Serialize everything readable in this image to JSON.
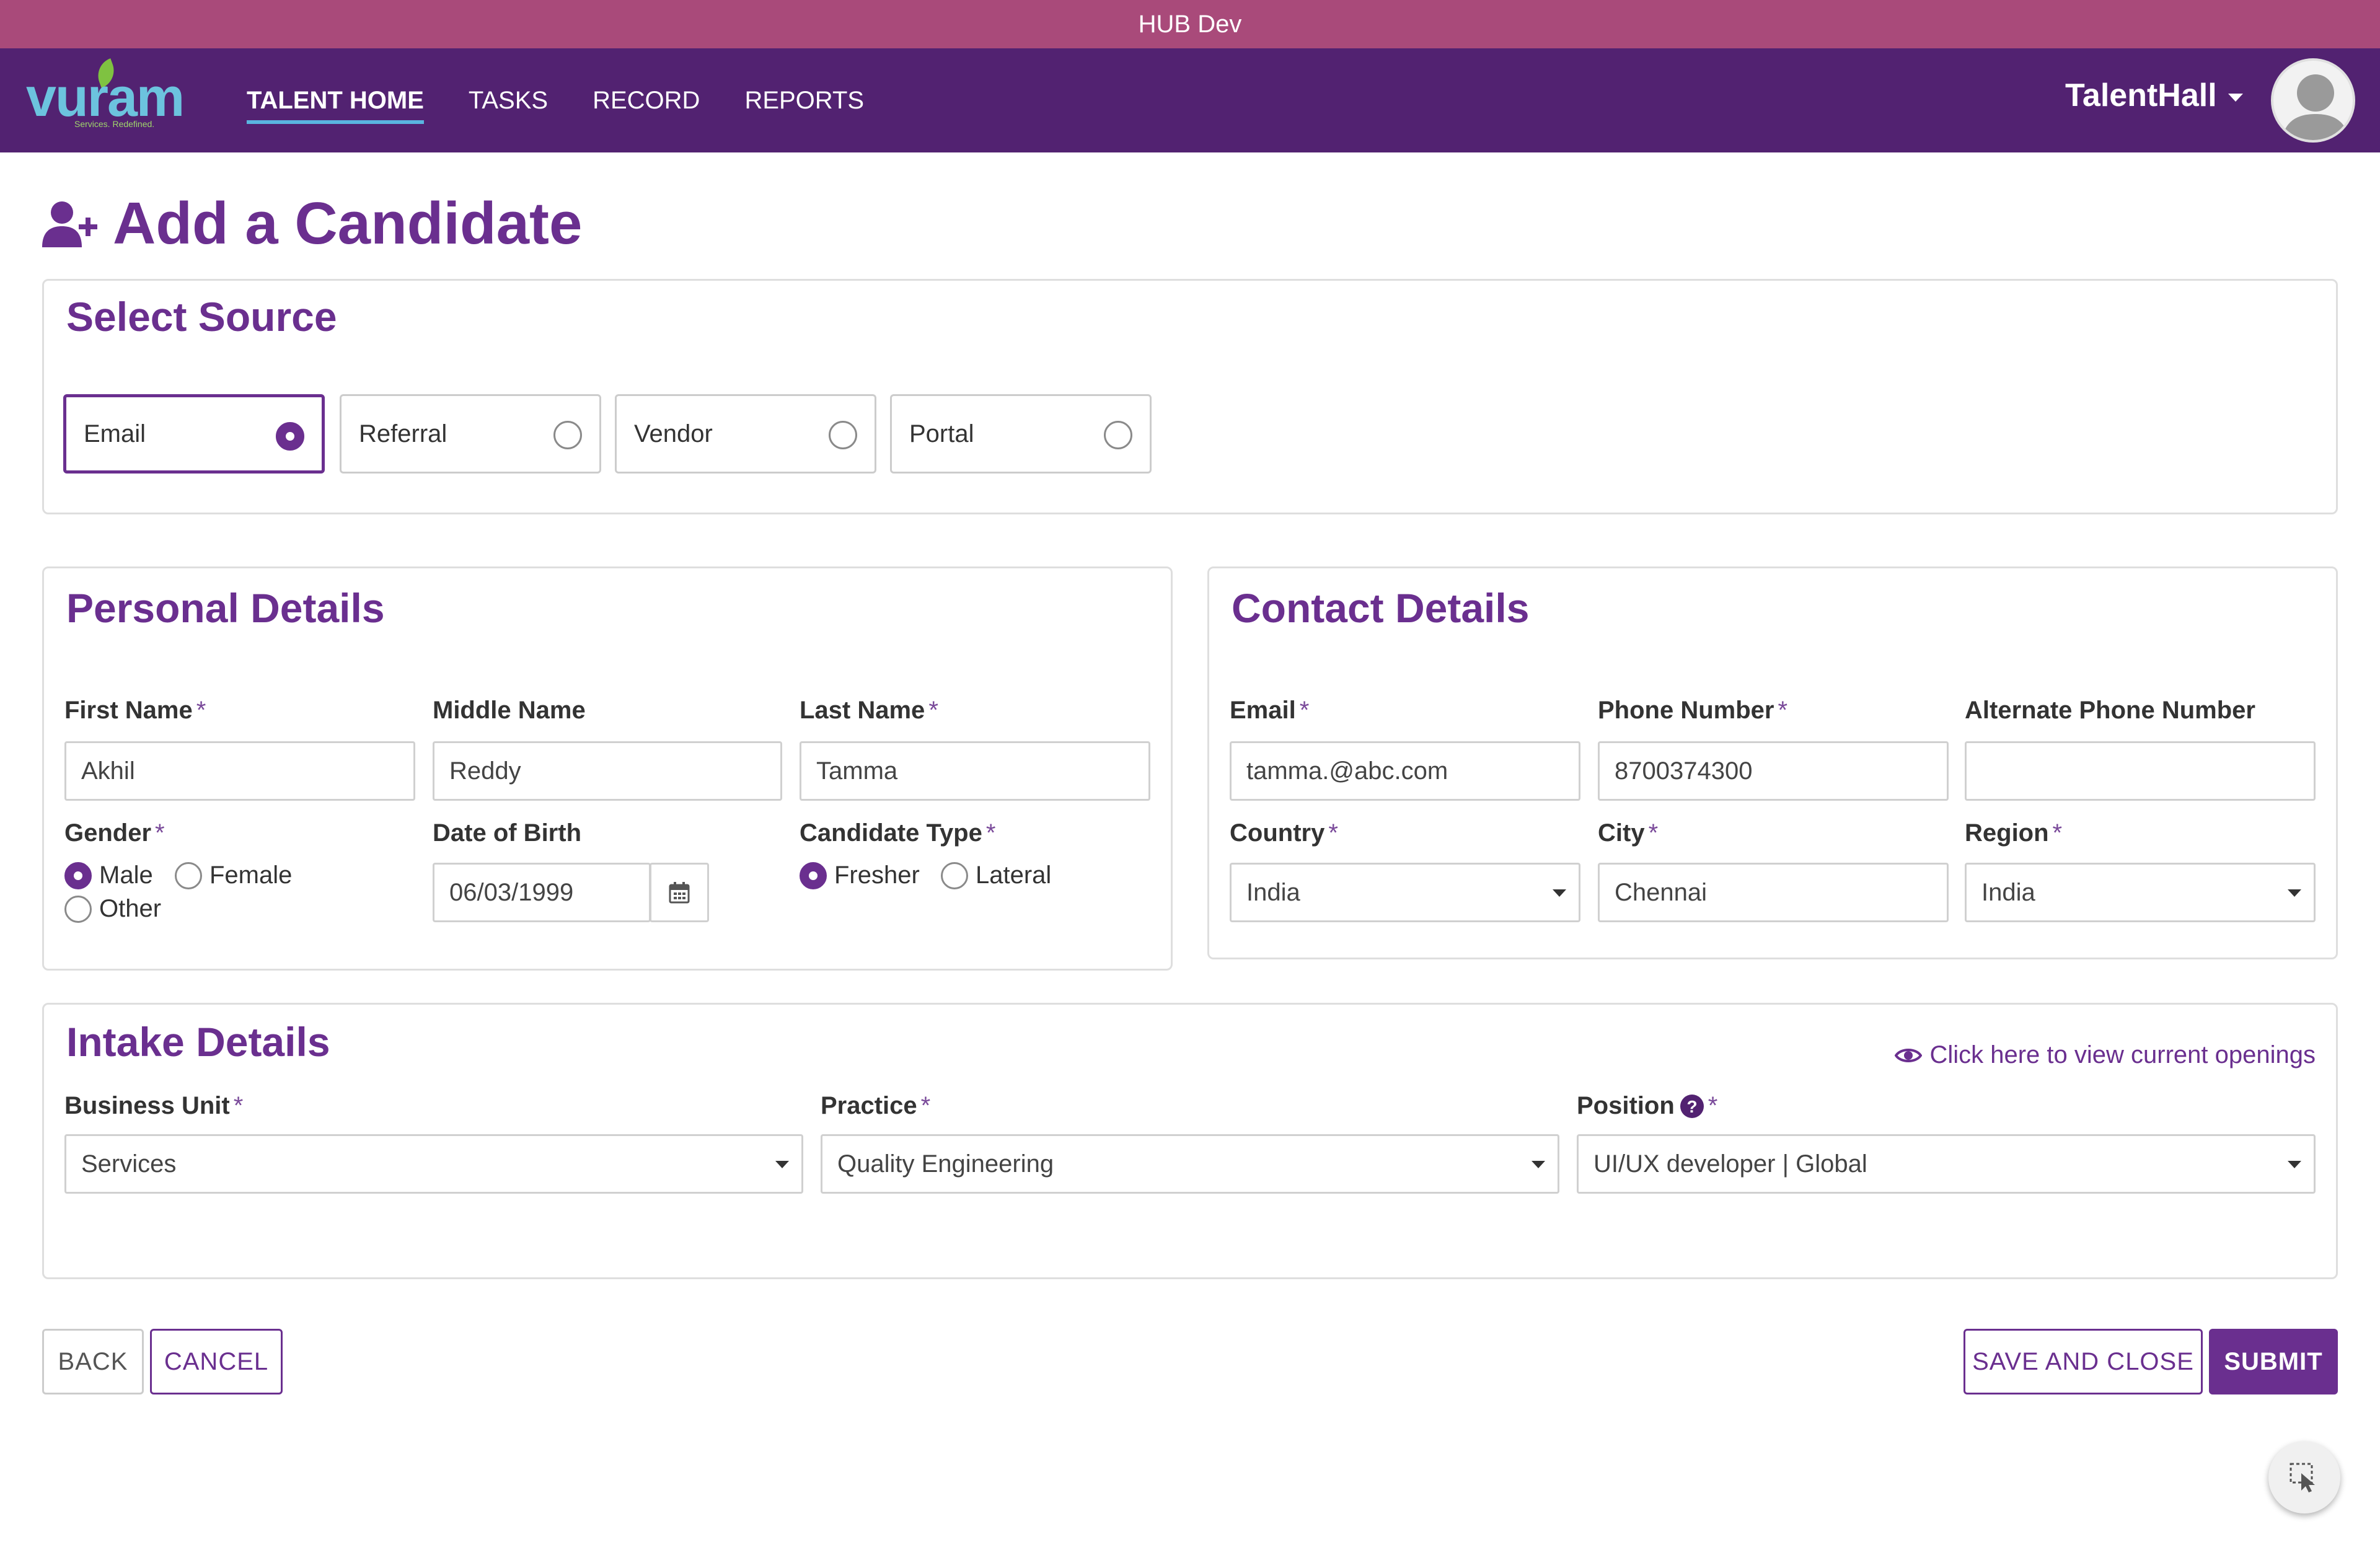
{
  "env": {
    "title": "HUB Dev"
  },
  "brand": {
    "logo_text": "vuram",
    "tagline": "Services. Redefined."
  },
  "nav": {
    "tabs": [
      {
        "label": "TALENT HOME",
        "active": true
      },
      {
        "label": "TASKS"
      },
      {
        "label": "RECORD"
      },
      {
        "label": "REPORTS"
      }
    ],
    "user": "TalentHall"
  },
  "page": {
    "title": "Add a Candidate",
    "icon": "user-plus-icon"
  },
  "source": {
    "title": "Select Source",
    "options": [
      {
        "label": "Email",
        "selected": true
      },
      {
        "label": "Referral"
      },
      {
        "label": "Vendor"
      },
      {
        "label": "Portal"
      }
    ]
  },
  "personal": {
    "title": "Personal Details",
    "first_name": {
      "label": "First Name",
      "value": "Akhil"
    },
    "middle_name": {
      "label": "Middle Name",
      "value": "Reddy"
    },
    "last_name": {
      "label": "Last Name",
      "value": "Tamma"
    },
    "gender": {
      "label": "Gender",
      "options": [
        "Male",
        "Female",
        "Other"
      ],
      "selected": "Male"
    },
    "dob": {
      "label": "Date of Birth",
      "value": "06/03/1999"
    },
    "candidate_type": {
      "label": "Candidate Type",
      "options": [
        "Fresher",
        "Lateral"
      ],
      "selected": "Fresher"
    }
  },
  "contact": {
    "title": "Contact Details",
    "email": {
      "label": "Email",
      "value": "tamma.@abc.com"
    },
    "phone": {
      "label": "Phone Number",
      "value": "8700374300"
    },
    "alt_phone": {
      "label": "Alternate Phone Number",
      "value": ""
    },
    "country": {
      "label": "Country",
      "value": "India"
    },
    "city": {
      "label": "City",
      "value": "Chennai"
    },
    "region": {
      "label": "Region",
      "value": "India"
    }
  },
  "intake": {
    "title": "Intake Details",
    "openings_link": "Click here to view current openings",
    "business_unit": {
      "label": "Business Unit",
      "value": "Services"
    },
    "practice": {
      "label": "Practice",
      "value": "Quality Engineering"
    },
    "position": {
      "label": "Position",
      "value": "UI/UX developer | Global"
    }
  },
  "actions": {
    "back": "BACK",
    "cancel": "CANCEL",
    "save_close": "SAVE AND CLOSE",
    "submit": "SUBMIT"
  },
  "colors": {
    "accent": "#6a2f8f",
    "nav_bg": "#522271",
    "env_bar": "#a94a7a"
  },
  "required_mark": "*"
}
